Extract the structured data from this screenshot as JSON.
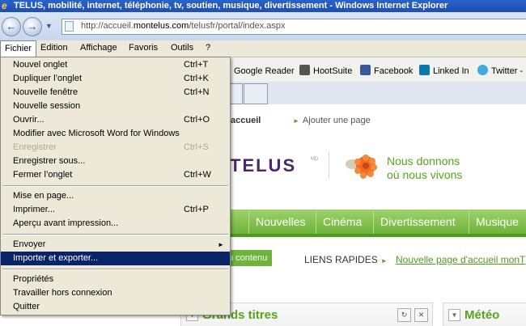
{
  "window": {
    "title": "TELUS, mobilité, internet, téléphonie, tv, soutien, musique, divertissement - Windows Internet Explorer",
    "logo_glyph": "e"
  },
  "address_bar": {
    "url_prefix": "http://accueil.",
    "url_domain": "montelus.com",
    "url_suffix": "/telusfr/portal/index.aspx"
  },
  "menu_bar": {
    "items": [
      "Fichier",
      "Edition",
      "Affichage",
      "Favoris",
      "Outils",
      "?"
    ]
  },
  "favorites": {
    "items": [
      {
        "label": "Google Reader",
        "icon": "google-reader-icon",
        "color": "#e34c26"
      },
      {
        "label": "HootSuite",
        "icon": "hootsuite-owl-icon",
        "color": "#555555"
      },
      {
        "label": "Facebook",
        "icon": "facebook-icon",
        "color": "#3b5998"
      },
      {
        "label": "Linked In",
        "icon": "linkedin-icon",
        "color": "#0e76a8"
      },
      {
        "label": "Twitter -",
        "icon": "twitter-icon",
        "color": "#3fa9e0"
      }
    ]
  },
  "file_menu": {
    "items": [
      {
        "label": "Nouvel onglet",
        "shortcut": "Ctrl+T"
      },
      {
        "label": "Dupliquer l’onglet",
        "shortcut": "Ctrl+K"
      },
      {
        "label": "Nouvelle fenêtre",
        "shortcut": "Ctrl+N"
      },
      {
        "label": "Nouvelle session",
        "shortcut": ""
      },
      {
        "label": "Ouvrir...",
        "shortcut": "Ctrl+O"
      },
      {
        "label": "Modifier avec Microsoft Word for Windows",
        "shortcut": ""
      },
      {
        "label": "Enregistrer",
        "shortcut": "Ctrl+S",
        "disabled": true
      },
      {
        "label": "Enregistrer sous...",
        "shortcut": ""
      },
      {
        "label": "Fermer l’onglet",
        "shortcut": "Ctrl+W"
      },
      {
        "label": "Mise en page...",
        "shortcut": ""
      },
      {
        "label": "Imprimer...",
        "shortcut": "Ctrl+P"
      },
      {
        "label": "Aperçu avant impression...",
        "shortcut": ""
      },
      {
        "label": "Envoyer",
        "shortcut": "",
        "submenu": true
      },
      {
        "label": "Importer et exporter...",
        "shortcut": "",
        "highlighted": true
      },
      {
        "label": "Propriétés",
        "shortcut": ""
      },
      {
        "label": "Travailler hors connexion",
        "shortcut": ""
      },
      {
        "label": "Quitter",
        "shortcut": ""
      }
    ]
  },
  "page": {
    "top_links": {
      "home": "accueil",
      "new_page": "Ajouter une page"
    },
    "logo_text": "TELUS",
    "logo_mark": "MD",
    "tagline_line1": "Nous donnons",
    "tagline_line2": "où nous vivons",
    "nav": [
      "eil",
      "Nouvelles",
      "Cinéma",
      "Divertissement",
      "Musique"
    ],
    "skip_button": "u contenu",
    "quick_links": "LIENS RAPIDES",
    "new_home_link": "Nouvelle page d'accueil monT",
    "panel_headlines": "Grands titres",
    "panel_weather": "Météo",
    "accent_green": "#55a51c",
    "brand_purple": "#4b286d"
  }
}
